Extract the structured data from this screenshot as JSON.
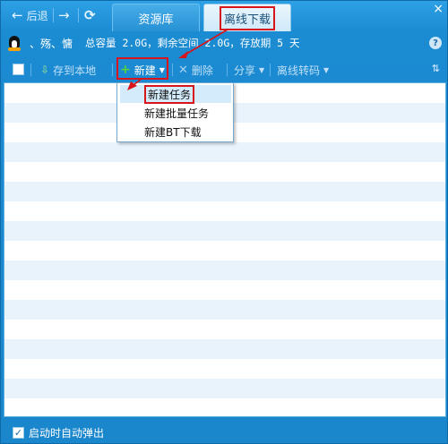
{
  "nav": {
    "back_label": "后退",
    "forward_icon": "→",
    "refresh_icon": "⟳"
  },
  "tabs": [
    {
      "label": "资源库"
    },
    {
      "label": "离线下载"
    }
  ],
  "window": {
    "close_icon": "×"
  },
  "account": {
    "username": "、殇、慵",
    "stats": "总容量 2.0G，剩余空间 2.0G，存放期 5 天",
    "help_icon": "?"
  },
  "toolbar": {
    "save_local": "存到本地",
    "new": "新建",
    "delete": "删除",
    "share": "分享",
    "transcode": "离线转码",
    "sort_icon": "⇅"
  },
  "new_menu": {
    "items": [
      {
        "label": "新建任务"
      },
      {
        "label": "新建批量任务"
      },
      {
        "label": "新建BT下载"
      }
    ]
  },
  "footer": {
    "autostart_label": "启动时自动弹出",
    "autostart_checked": true
  },
  "colors": {
    "annotation": "#d8141c",
    "chrome": "#1b8bd2"
  }
}
